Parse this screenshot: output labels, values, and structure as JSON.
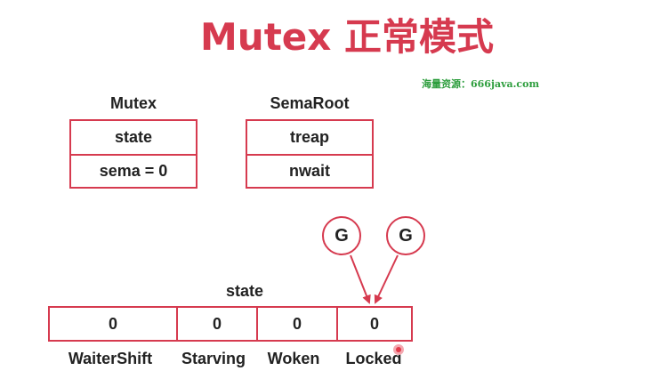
{
  "title": "Mutex 正常模式",
  "watermark": "海量资源：666java.com",
  "mutex": {
    "name": "Mutex",
    "fields": [
      "state",
      "sema = 0"
    ]
  },
  "semaroot": {
    "name": "SemaRoot",
    "fields": [
      "treap",
      "nwait"
    ]
  },
  "state": {
    "label": "state",
    "bits": [
      {
        "value": "0",
        "label": "WaiterShift"
      },
      {
        "value": "0",
        "label": "Starving"
      },
      {
        "value": "0",
        "label": "Woken"
      },
      {
        "value": "0",
        "label": "Locked"
      }
    ]
  },
  "goroutines": [
    "G",
    "G"
  ],
  "colors": {
    "accent": "#d63a4f",
    "watermark": "#2e9e3e",
    "text": "#222222"
  }
}
